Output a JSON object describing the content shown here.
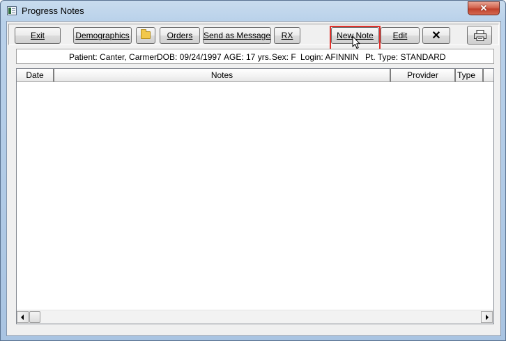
{
  "window": {
    "title": "Progress Notes",
    "close_glyph": "✕"
  },
  "toolbar": {
    "exit_label": "Exit",
    "demographics_label": "Demographics",
    "folder_icon": "folder-icon",
    "orders_label": "Orders",
    "send_message_label": "Send as Message",
    "rx_label": "RX",
    "new_note_label": "New Note",
    "edit_label": "Edit",
    "delete_glyph": "✕",
    "print_icon": "printer-icon"
  },
  "patient": {
    "name": "Patient: Canter, Carmen",
    "dob": "DOB: 09/24/1997",
    "age": "AGE: 17 yrs.",
    "sex": "Sex: F",
    "login": "Login: AFINNIN",
    "pt_type": "Pt. Type: STANDARD"
  },
  "grid": {
    "columns": [
      "Date",
      "Notes",
      "Provider",
      "Type"
    ],
    "rows": []
  },
  "colors": {
    "highlight": "#e0302a",
    "close_button": "#c0402b"
  }
}
